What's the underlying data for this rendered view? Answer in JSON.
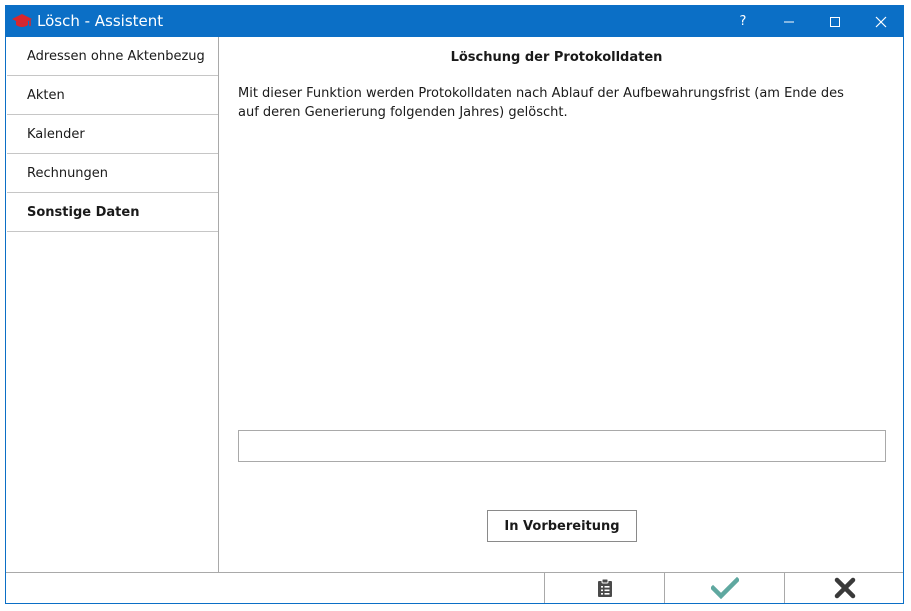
{
  "window": {
    "title": "Lösch - Assistent",
    "help_label": "?",
    "app_icon": "graduation-cap-icon"
  },
  "colors": {
    "titlebar": "#0b6fc6",
    "ok_check": "#5fa8a0",
    "cancel_x": "#3a3a3a"
  },
  "sidebar": {
    "items": [
      {
        "label": "Adressen ohne Aktenbezug",
        "active": false
      },
      {
        "label": "Akten",
        "active": false
      },
      {
        "label": "Kalender",
        "active": false
      },
      {
        "label": "Rechnungen",
        "active": false
      },
      {
        "label": "Sonstige Daten",
        "active": true
      }
    ]
  },
  "content": {
    "title": "Löschung der Protokolldaten",
    "description": "Mit dieser Funktion werden Protokolldaten nach Ablauf der Aufbewahrungsfrist (am Ende des auf deren Generierung folgenden Jahres) gelöscht.",
    "progress_value": "",
    "button_label": "In Vorbereitung"
  },
  "footer": {
    "buttons": [
      {
        "icon": "clipboard-icon"
      },
      {
        "icon": "checkmark-icon"
      },
      {
        "icon": "close-x-icon"
      }
    ]
  }
}
